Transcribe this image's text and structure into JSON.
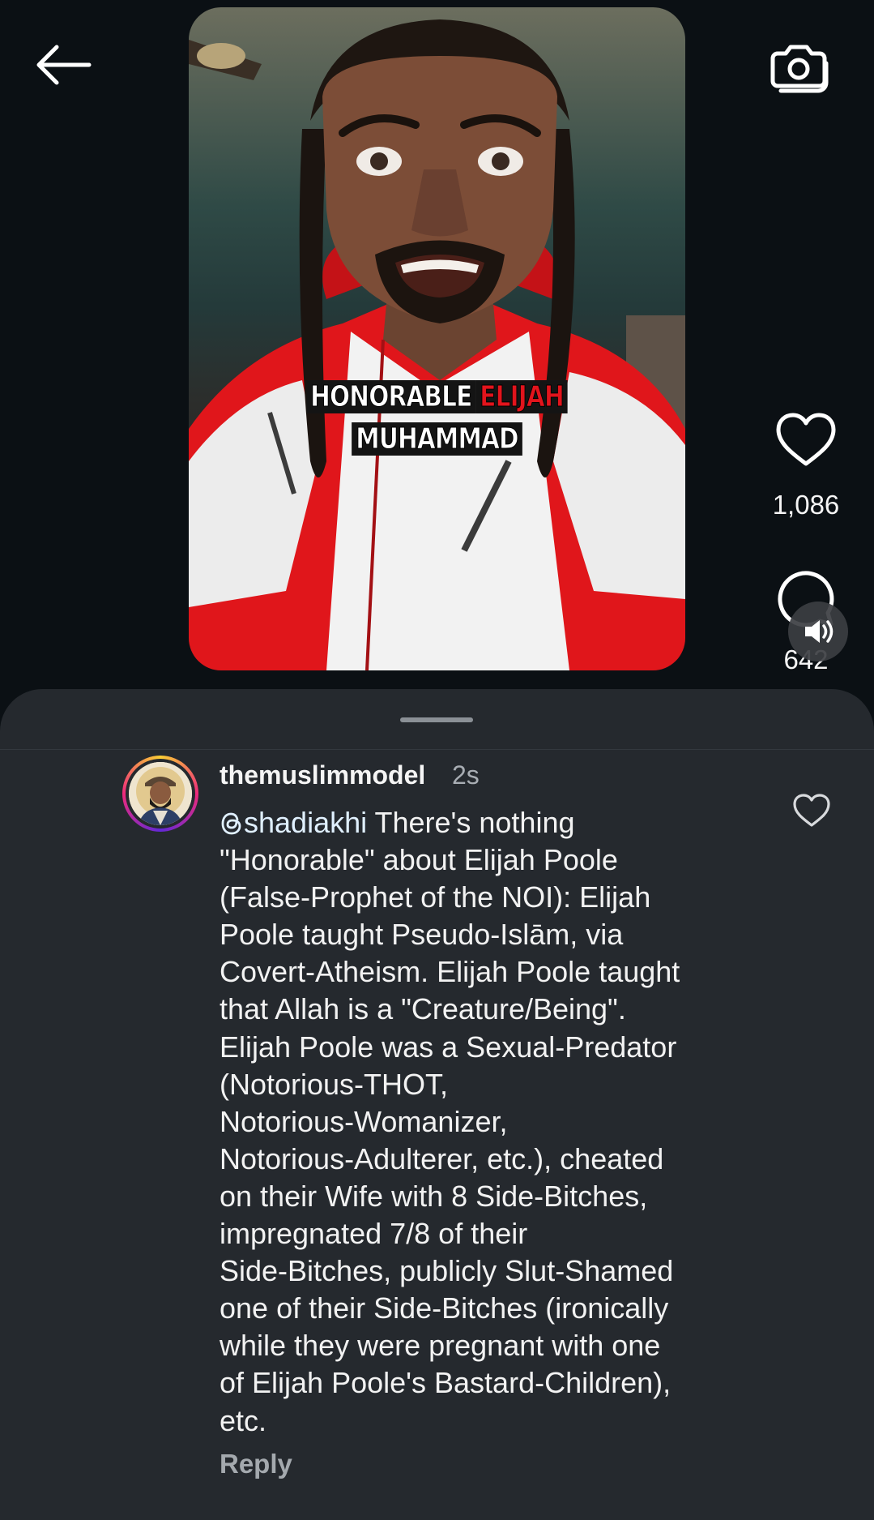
{
  "video": {
    "caption_line1_white": "HONORABLE",
    "caption_line1_red": "ELIJAH",
    "caption_line2": "MUHAMMAD"
  },
  "actions": {
    "like_count": "1,086",
    "comment_count": "642"
  },
  "comment": {
    "username": "themuslimmodel",
    "timestamp": "2s",
    "mention": "shadiakhi",
    "lines": [
      " There's nothing",
      "\"Honorable\" about Elijah Poole",
      "(False-Prophet of the NOI): Elijah",
      "Poole taught Pseudo-Islām, via",
      "Covert-Atheism. Elijah Poole taught",
      "that Allah is a \"Creature/Being\".",
      "Elijah Poole was a Sexual-Predator",
      "(Notorious-THOT,",
      "Notorious-Womanizer,",
      "Notorious-Adulterer, etc.), cheated",
      "on their Wife with 8 Side-Bitches,",
      "impregnated 7/8 of their",
      "Side-Bitches, publicly Slut-Shamed",
      "one of their Side-Bitches (ironically",
      "while they were pregnant with one",
      "of Elijah Poole's Bastard-Children),",
      "etc."
    ],
    "reply_label": "Reply"
  },
  "icons": {
    "back": "arrow-left-icon",
    "camera": "camera-icon",
    "like": "heart-icon",
    "comment": "comment-bubble-icon",
    "volume": "speaker-icon",
    "threads": "threads-icon"
  }
}
